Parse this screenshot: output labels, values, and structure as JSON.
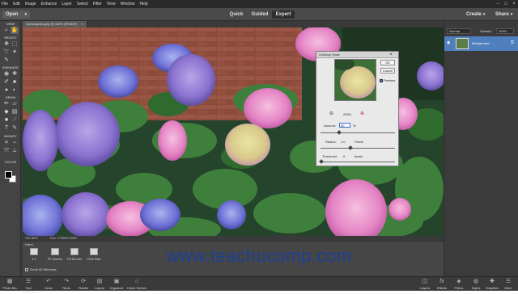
{
  "menubar": {
    "items": [
      "File",
      "Edit",
      "Image",
      "Enhance",
      "Layer",
      "Select",
      "Filter",
      "View",
      "Window",
      "Help"
    ]
  },
  "modebar": {
    "open_label": "Open",
    "tabs": [
      {
        "label": "Quick"
      },
      {
        "label": "Guided"
      },
      {
        "label": "Expert"
      }
    ],
    "create_label": "Create",
    "share_label": "Share"
  },
  "toolbox": {
    "sections": [
      "VIEW",
      "SELECT",
      "ENHANCE",
      "DRAW",
      "MODIFY",
      "COLOR"
    ]
  },
  "document": {
    "tab_label": "hydrangeas.jpeg @ 162% (RGB/8*)",
    "status_zoom": "161.88%",
    "status_doc": "Doc: 3.55M/3.55M"
  },
  "dialog": {
    "title": "Unsharp Mask",
    "ok_label": "OK",
    "cancel_label": "Cancel",
    "preview_label": "Preview",
    "preview_checked": true,
    "zoom_value": "200%",
    "amount_label": "Amount:",
    "amount_value": "50",
    "amount_unit": "%",
    "radius_label": "Radius:",
    "radius_value": "1.0",
    "radius_unit": "Pixels",
    "threshold_label": "Threshold:",
    "threshold_value": "0",
    "threshold_unit": "levels"
  },
  "layers": {
    "mode": "Normal",
    "opacity_label": "Opacity:",
    "opacity_value": "100%",
    "layer_name": "Background"
  },
  "tool_options": {
    "tool_name": "Hand",
    "buttons": [
      {
        "label": "1:1"
      },
      {
        "label": "Fit Screen"
      },
      {
        "label": "Fill Screen"
      },
      {
        "label": "Print Size"
      }
    ],
    "scroll_all": "Scroll All Windows"
  },
  "taskbar": {
    "left": [
      {
        "label": "Photo Bin",
        "icon": "photo-bin-icon"
      },
      {
        "label": "Tool Options",
        "icon": "tool-options-icon"
      },
      {
        "label": "Undo",
        "icon": "undo-icon"
      },
      {
        "label": "Redo",
        "icon": "redo-icon"
      },
      {
        "label": "Rotate",
        "icon": "rotate-icon"
      },
      {
        "label": "Layout",
        "icon": "layout-icon"
      },
      {
        "label": "Organizer",
        "icon": "organizer-icon"
      },
      {
        "label": "Home Screen",
        "icon": "home-icon"
      }
    ],
    "right": [
      {
        "label": "Layers",
        "icon": "layers-icon"
      },
      {
        "label": "Effects",
        "icon": "effects-icon"
      },
      {
        "label": "Filters",
        "icon": "filters-icon"
      },
      {
        "label": "Styles",
        "icon": "styles-icon"
      },
      {
        "label": "Graphics",
        "icon": "graphics-icon"
      },
      {
        "label": "More",
        "icon": "more-icon"
      }
    ]
  },
  "watermark": "www.teachucomp.com",
  "colors": {
    "accent": "#1c3f96",
    "panel": "#3b3b3b",
    "layer_highlight": "#4f7fbd"
  }
}
